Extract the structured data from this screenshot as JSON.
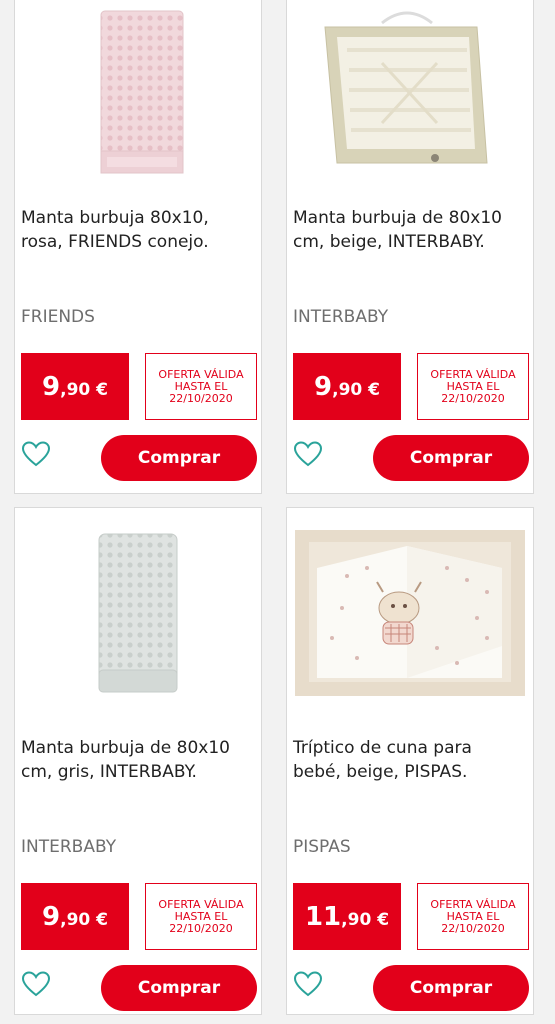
{
  "accent_color": "#e2001a",
  "products": [
    {
      "title": "Manta burbuja 80x10, rosa, FRIENDS conejo.",
      "brand": "FRIENDS",
      "price_int": "9",
      "price_dec": ",90 €",
      "offer_line1": "OFERTA VÁLIDA",
      "offer_line2": "HASTA EL",
      "offer_line3": "22/10/2020",
      "buy_label": "Comprar",
      "image": "pink-bubble-blanket",
      "favorite_icon": "heart-outline-icon"
    },
    {
      "title": "Manta burbuja de 80x10 cm, beige, INTERBABY.",
      "brand": "INTERBABY",
      "price_int": "9",
      "price_dec": ",90 €",
      "offer_line1": "OFERTA VÁLIDA",
      "offer_line2": "HASTA EL",
      "offer_line3": "22/10/2020",
      "buy_label": "Comprar",
      "image": "beige-blanket-gift-box",
      "favorite_icon": "heart-outline-icon"
    },
    {
      "title": "Manta burbuja de 80x10 cm, gris, INTERBABY.",
      "brand": "INTERBABY",
      "price_int": "9",
      "price_dec": ",90 €",
      "offer_line1": "OFERTA VÁLIDA",
      "offer_line2": "HASTA EL",
      "offer_line3": "22/10/2020",
      "buy_label": "Comprar",
      "image": "grey-bubble-blanket",
      "favorite_icon": "heart-outline-icon"
    },
    {
      "title": "Tríptico de cuna para bebé, beige, PISPAS.",
      "brand": "PISPAS",
      "price_int": "11",
      "price_dec": ",90 €",
      "offer_line1": "OFERTA VÁLIDA",
      "offer_line2": "HASTA EL",
      "offer_line3": "22/10/2020",
      "buy_label": "Comprar",
      "image": "crib-set-deer-print",
      "favorite_icon": "heart-outline-icon"
    }
  ]
}
